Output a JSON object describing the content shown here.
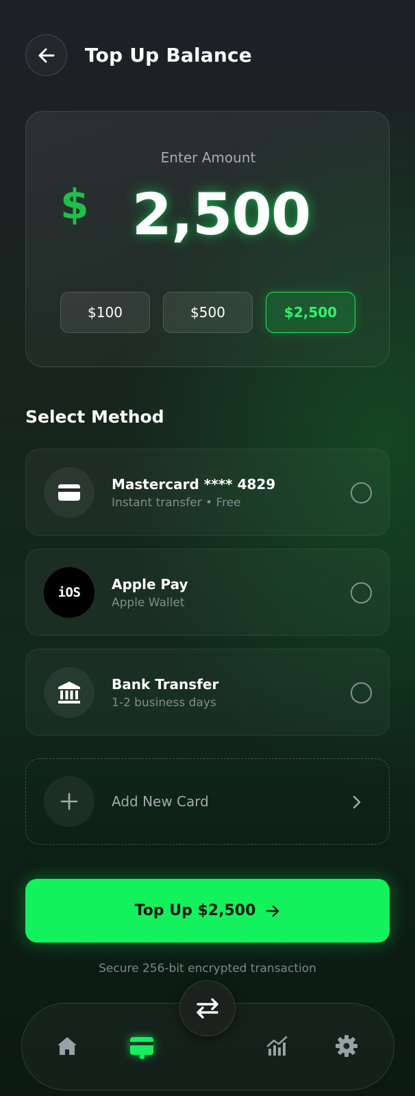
{
  "header": {
    "title": "Top Up Balance"
  },
  "amount": {
    "label": "Enter Amount",
    "currency_symbol": "$",
    "value": "2,500",
    "presets": [
      {
        "label": "$100",
        "selected": false
      },
      {
        "label": "$500",
        "selected": false
      },
      {
        "label": "$2,500",
        "selected": true
      }
    ]
  },
  "methods": {
    "title": "Select Method",
    "items": [
      {
        "title": "Mastercard **** 4829",
        "subtitle": "Instant transfer • Free",
        "icon": "credit-card-icon"
      },
      {
        "title": "Apple Pay",
        "subtitle": "Apple Wallet",
        "icon": "ios-icon",
        "icon_text": "iOS"
      },
      {
        "title": "Bank Transfer",
        "subtitle": "1-2 business days",
        "icon": "bank-icon"
      }
    ],
    "add_card_label": "Add New Card"
  },
  "cta": {
    "label": "Top Up $2,500",
    "note": "Secure 256-bit encrypted transaction"
  },
  "nav": {
    "items": [
      "home-icon",
      "card-icon",
      "transfer-icon",
      "chart-icon",
      "gear-icon"
    ],
    "active": "card-icon"
  },
  "colors": {
    "accent": "#13f25d",
    "dollar": "#1fbf4a"
  }
}
